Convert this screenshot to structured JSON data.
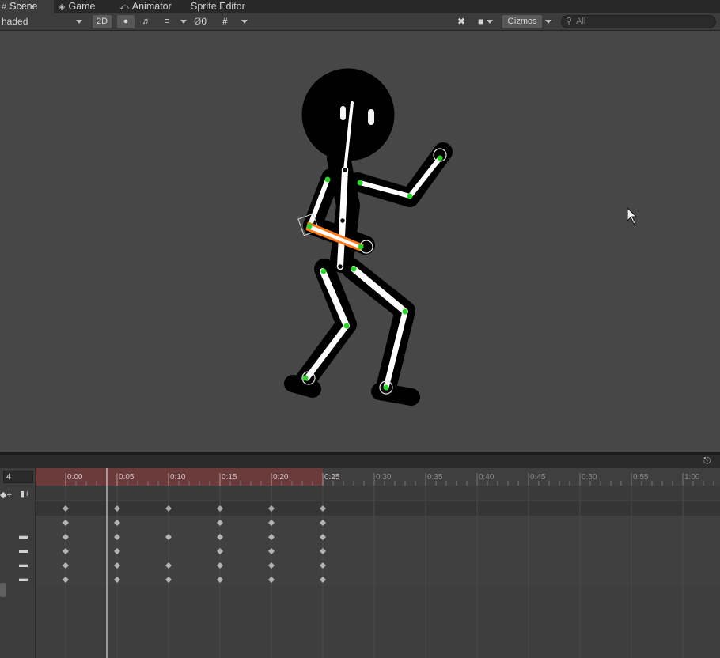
{
  "tabs": [
    {
      "label": "Scene",
      "icon": "grid-icon"
    },
    {
      "label": "Game",
      "icon": "gamepad-icon"
    },
    {
      "label": "Animator",
      "icon": "animator-icon"
    },
    {
      "label": "Sprite Editor",
      "icon": ""
    }
  ],
  "toolbar": {
    "shading_mode": "haded",
    "btn_2d": "2D",
    "hidden_count": "0",
    "gizmos_label": "Gizmos",
    "search_placeholder": "All"
  },
  "animation": {
    "frame_value": "4",
    "ruler_labels": [
      "0:00",
      "0:05",
      "0:10",
      "0:15",
      "0:20",
      "0:25",
      "0:30",
      "0:35",
      "0:40",
      "0:45",
      "0:50",
      "0:55",
      "1:00"
    ],
    "keyframe_rows": [
      [
        0,
        5,
        15,
        20,
        25
      ],
      [
        0,
        5,
        10,
        15,
        20,
        25
      ],
      [
        0,
        5,
        15,
        20,
        25
      ],
      [
        0,
        5,
        10,
        15,
        20,
        25
      ],
      [
        0,
        5,
        10,
        15,
        20,
        25
      ]
    ],
    "playhead_frame": 4,
    "clip_end_frame": 25
  },
  "colors": {
    "bone_selected": "#ff7a1a",
    "joint": "#2fd12f",
    "clip_range": "#6b3a3a",
    "playhead": "#f0f0f0"
  }
}
